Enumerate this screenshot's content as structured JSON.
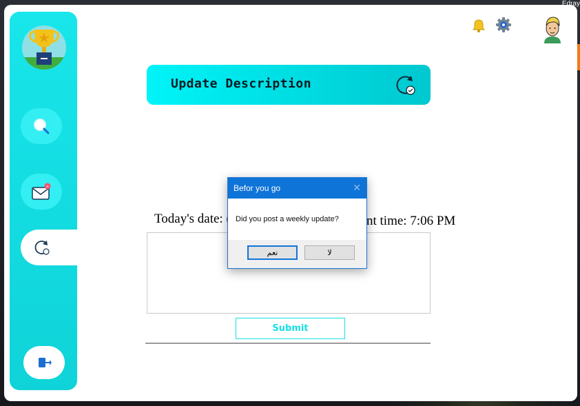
{
  "desktop": {
    "corner_text": "Edray"
  },
  "header": {
    "bell_icon": "bell-icon",
    "settings_icon": "gear-icon",
    "profile_icon": "avatar"
  },
  "sidebar": {
    "logo_icon": "trophy-icon",
    "items": [
      {
        "name": "search",
        "icon": "search-icon"
      },
      {
        "name": "mail",
        "icon": "mail-icon"
      },
      {
        "name": "update",
        "icon": "refresh-icon"
      }
    ],
    "logout_icon": "logout-icon"
  },
  "main": {
    "title": "Update Description",
    "date_label": "Today's date: (",
    "time_label": "nt time: 7:06 PM",
    "submit_label": "Submit"
  },
  "dialog": {
    "title": "Befor you go",
    "message": "Did you post a weekly update?",
    "yes_label": "نعم",
    "no_label": "لا"
  },
  "colors": {
    "accent": "#16e0e6",
    "dialog_title": "#0f74d8"
  }
}
